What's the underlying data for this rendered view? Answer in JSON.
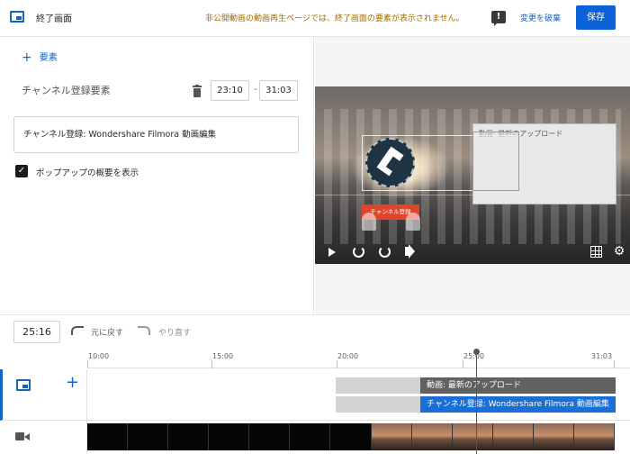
{
  "header": {
    "title": "終了画面",
    "warning": "非公開動画の動画再生ページでは、終了画面の要素が表示されません。",
    "discard_label": "変更を破棄",
    "save_label": "保存",
    "feedback_icon": "!"
  },
  "left": {
    "add_element_label": "要素",
    "element_title": "チャンネル登録要素",
    "start_time": "23:10",
    "end_time": "31:03",
    "channel_value": "チャンネル登録: Wondershare Filmora 動画編集",
    "checkbox_label": "ポップアップの概要を表示",
    "checkbox_checked": true
  },
  "preview": {
    "subscribe_label": "チャンネル登録",
    "latest_upload_label": "動画: 最新のアップロード"
  },
  "toolbar": {
    "current_time": "25:16",
    "undo_label": "元に戻す",
    "redo_label": "やり直す"
  },
  "timeline": {
    "ticks": [
      "10:00",
      "15:00",
      "20:00",
      "25:00",
      "31:03"
    ],
    "tracks": [
      {
        "label": "動画: 最新のアップロード"
      },
      {
        "label": "チャンネル登録: Wondershare Filmora 動画編集"
      }
    ]
  },
  "colors": {
    "accent": "#1565c0",
    "save_button": "#0b62d8",
    "warning_text": "#a26e00",
    "channel_bar": "#1a6fd6",
    "video_bar": "#616161",
    "subscribe_button": "#e0452c"
  }
}
